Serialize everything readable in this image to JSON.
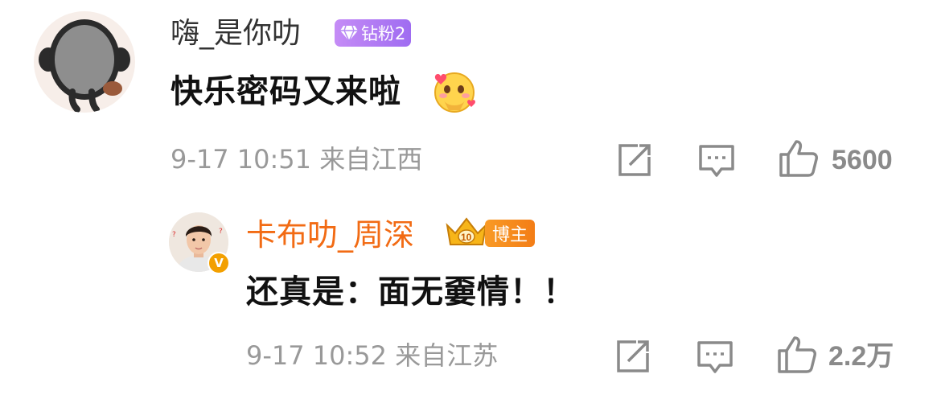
{
  "comment": {
    "username": "嗨_是你叻",
    "badge_label": "钻粉2",
    "text": "快乐密码又来啦",
    "meta": "9-17 10:51 来自江西",
    "like_count": "5600"
  },
  "reply": {
    "username": "卡布叻_周深",
    "badge_label": "博主",
    "text": "还真是：面无嫑情！！",
    "meta": "9-17 10:52 来自江苏",
    "like_count": "2.2万",
    "verified_mark": "V"
  },
  "icons": {
    "share": "share-edit-icon",
    "comment": "comment-icon",
    "like": "thumbs-up-icon"
  },
  "colors": {
    "name_orange": "#f26b14",
    "badge_purple": "#a974f3",
    "badge_orange": "#f58a1d",
    "meta_gray": "#999999"
  }
}
